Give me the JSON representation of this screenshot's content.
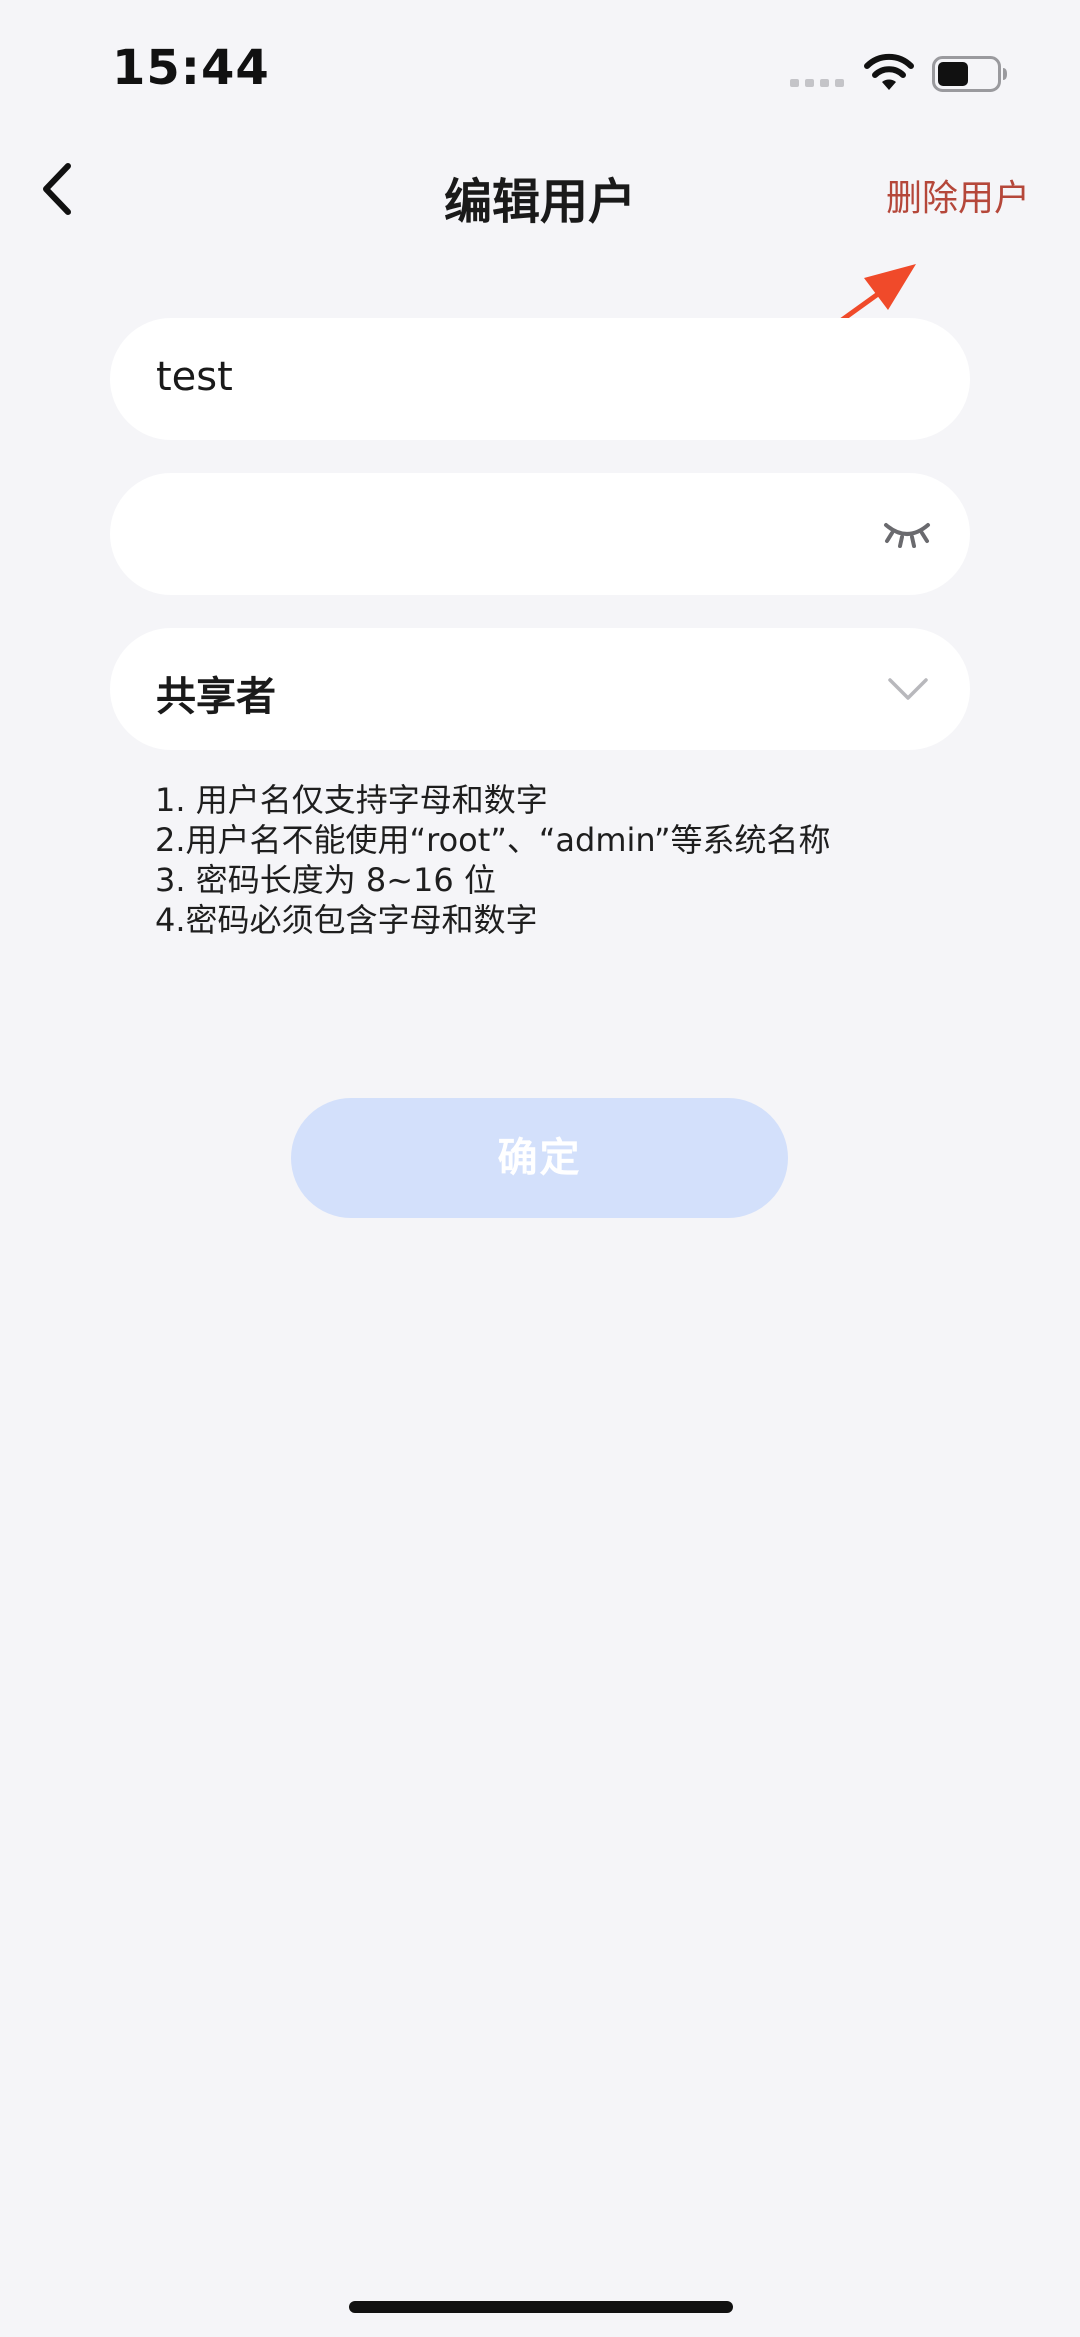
{
  "status_bar": {
    "time": "15:44"
  },
  "nav": {
    "title": "编辑用户",
    "action_label": "删除用户",
    "back_icon": "chevron-left-icon"
  },
  "form": {
    "username_value": "test",
    "password_value": "",
    "password_icon": "eye-closed-icon",
    "role_value": "共享者",
    "role_icon": "chevron-down-icon"
  },
  "rules": [
    "1. 用户名仅支持字母和数字",
    "2.用户名不能使用“root”、“admin”等系统名称",
    "3. 密码长度为 8~16 位",
    "4.密码必须包含字母和数字"
  ],
  "confirm": {
    "label": "确定"
  },
  "colors": {
    "background": "#f5f5f8",
    "delete_action": "#b5473a",
    "confirm_disabled": "#d3e0fb",
    "annotation_arrow": "#f04a2a"
  }
}
